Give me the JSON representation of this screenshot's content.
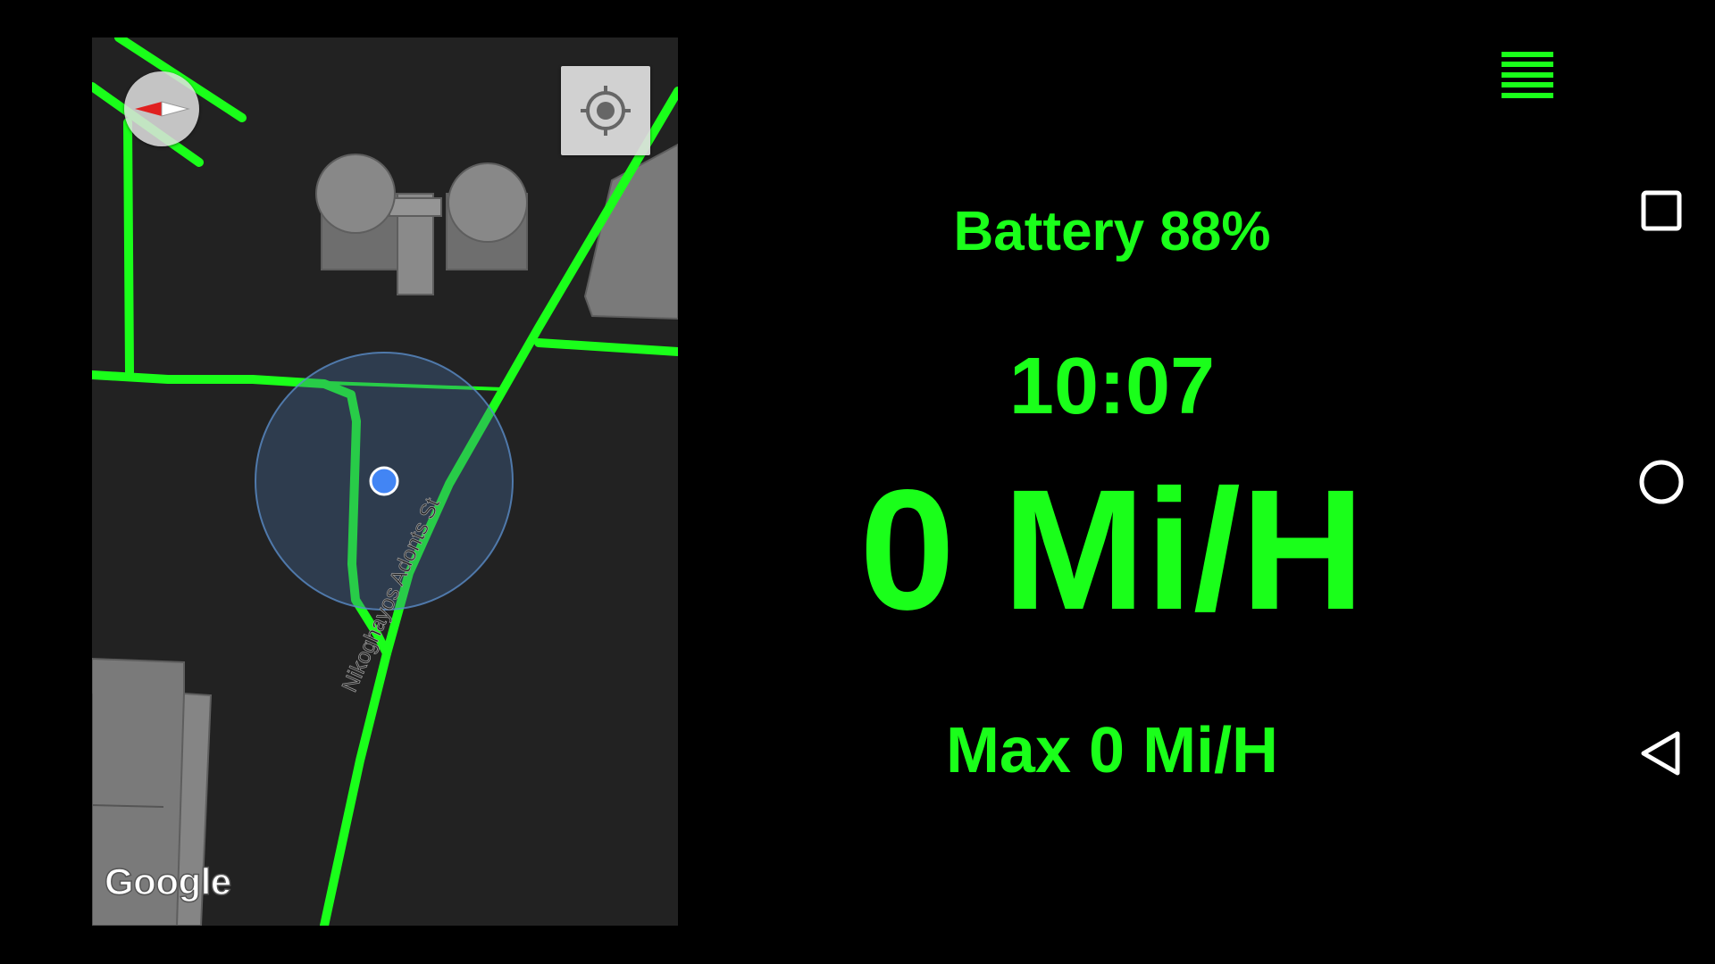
{
  "map": {
    "street_label": "Nikoghayos Adonts St",
    "logo_text": "Google",
    "route_color": "#1aff1a",
    "location_dot_color": "#4285f4",
    "compass_icon": "compass-icon",
    "locate_icon": "my-location-icon"
  },
  "dashboard": {
    "battery": "Battery 88%",
    "time": "10:07",
    "speed": "0 Mi/H",
    "max_speed": "Max 0 Mi/H",
    "text_color": "#1aff1a",
    "menu_icon": "menu-icon"
  },
  "navbar": {
    "recents_icon": "recents-icon",
    "home_icon": "home-icon",
    "back_icon": "back-icon"
  }
}
